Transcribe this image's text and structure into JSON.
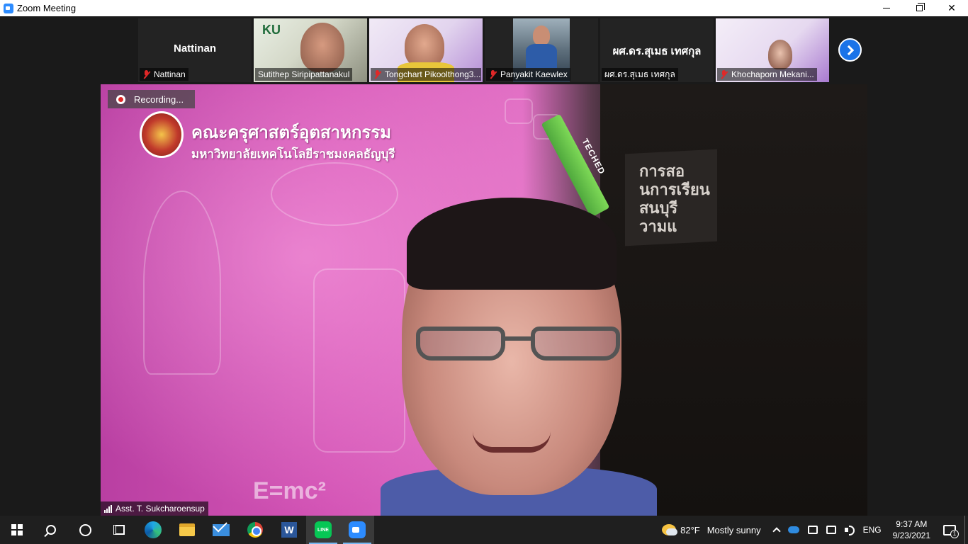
{
  "window": {
    "title": "Zoom Meeting",
    "controls": [
      "minimize",
      "restore",
      "close"
    ]
  },
  "participants_strip": {
    "tiles": [
      {
        "display_name": "Nattinan",
        "name_label": "Nattinan",
        "muted": true,
        "video": false
      },
      {
        "name_label": "Sutithep Siripipattanakul",
        "muted": false,
        "video": true,
        "overlay_text": "KU"
      },
      {
        "name_label": "Tongchart Pikoolthong3...",
        "muted": true,
        "video": true
      },
      {
        "name_label": "Panyakit Kaewlex",
        "muted": true,
        "video": true
      },
      {
        "display_name": "ผศ.ดร.สุเมธ เทศกุล",
        "name_label": "ผศ.ดร.สุเมธ เทศกุล",
        "muted": false,
        "video": false
      },
      {
        "name_label": "Khochaporn Mekani...",
        "muted": true,
        "video": true
      }
    ],
    "next_page_icon": "chevron-right-icon"
  },
  "main_video": {
    "recording_label": "Recording...",
    "speaker_name": "Asst. T. Sukcharoensup",
    "background_title": "คณะครุศาสตร์อุตสาหกรรม",
    "background_subtitle": "มหาวิทยาลัยเทคโนโลยีราชมงคลธัญบุรี",
    "pencil_label": "TECHED",
    "formula": "E=mc²",
    "board_text": "การสอ\nนการเรียน\nสนบุรี\nวามแ"
  },
  "taskbar": {
    "apps": [
      "start",
      "search",
      "cortana",
      "task-view",
      "edge",
      "file-explorer",
      "mail",
      "chrome",
      "word",
      "line",
      "zoom"
    ],
    "line_label": "LINE",
    "word_label": "W",
    "weather_temp": "82°F",
    "weather_text": "Mostly sunny",
    "language": "ENG",
    "time": "9:37 AM",
    "date": "9/23/2021",
    "notification_count": "1"
  },
  "colors": {
    "zoom_blue": "#2d8cff",
    "muted_red": "#e02828",
    "stage_bg": "#1a1a1a",
    "taskbar_bg": "#1f1f1f"
  }
}
